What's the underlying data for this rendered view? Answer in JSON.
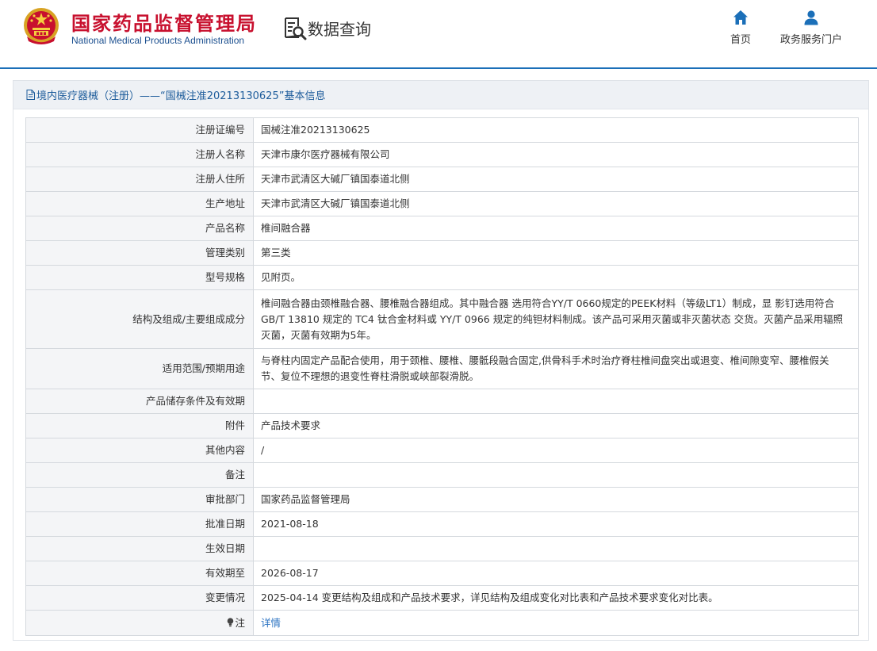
{
  "header": {
    "title_cn": "国家药品监督管理局",
    "title_en": "National Medical Products Administration",
    "query_label": "数据查询",
    "nav": [
      {
        "label": "首页",
        "icon": "home-icon"
      },
      {
        "label": "政务服务门户",
        "icon": "user-icon"
      }
    ]
  },
  "panel": {
    "title": "境内医疗器械（注册）——“国械注准20213130625”基本信息"
  },
  "rows": [
    {
      "label": "注册证编号",
      "value": "国械注准20213130625"
    },
    {
      "label": "注册人名称",
      "value": "天津市康尔医疗器械有限公司"
    },
    {
      "label": "注册人住所",
      "value": "天津市武清区大碱厂镇国泰道北侧"
    },
    {
      "label": "生产地址",
      "value": "天津市武清区大碱厂镇国泰道北侧"
    },
    {
      "label": "产品名称",
      "value": "椎间融合器"
    },
    {
      "label": "管理类别",
      "value": "第三类"
    },
    {
      "label": "型号规格",
      "value": "见附页。"
    },
    {
      "label": "结构及组成/主要组成成分",
      "value": "椎间融合器由颈椎融合器、腰椎融合器组成。其中融合器 选用符合YY/T 0660规定的PEEK材料（等级LT1）制成，显 影钉选用符合 GB/T 13810 规定的 TC4 钛合金材料或 YY/T 0966 规定的纯钽材料制成。该产品可采用灭菌或非灭菌状态 交货。灭菌产品采用辐照灭菌，灭菌有效期为5年。"
    },
    {
      "label": "适用范围/预期用途",
      "value": "与脊柱内固定产品配合使用，用于颈椎、腰椎、腰骶段融合固定,供骨科手术时治疗脊柱椎间盘突出或退变、椎间隙变窄、腰椎假关节、复位不理想的退变性脊柱滑脱或峡部裂滑脱。"
    },
    {
      "label": "产品储存条件及有效期",
      "value": ""
    },
    {
      "label": "附件",
      "value": "产品技术要求"
    },
    {
      "label": "其他内容",
      "value": "/"
    },
    {
      "label": "备注",
      "value": ""
    },
    {
      "label": "审批部门",
      "value": "国家药品监督管理局"
    },
    {
      "label": "批准日期",
      "value": "2021-08-18"
    },
    {
      "label": "生效日期",
      "value": ""
    },
    {
      "label": "有效期至",
      "value": "2026-08-17"
    },
    {
      "label": "变更情况",
      "value": "2025-04-14 变更结构及组成和产品技术要求，详见结构及组成变化对比表和产品技术要求变化对比表。"
    },
    {
      "label": "注",
      "value": "详情",
      "icon": "bulb-icon"
    }
  ],
  "colors": {
    "title_red": "#c8102e",
    "accent_blue": "#1b6fb8",
    "link_blue": "#2b73c2",
    "label_bg": "#f4f5f7"
  }
}
